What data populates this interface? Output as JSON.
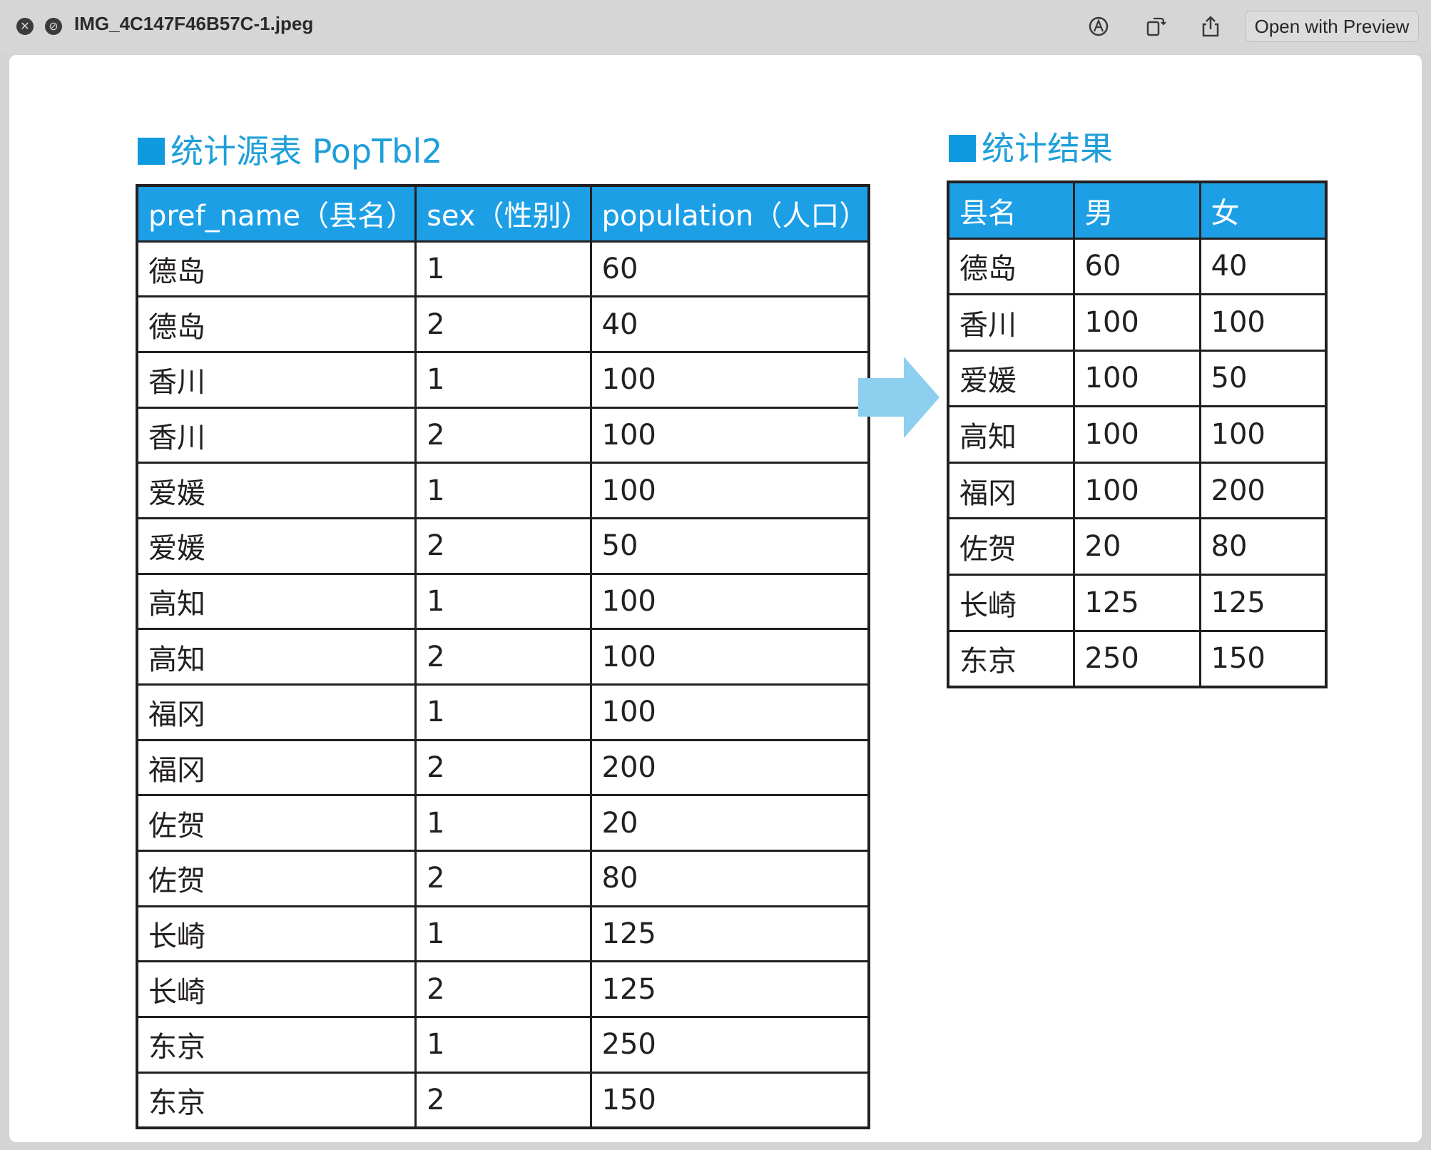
{
  "window": {
    "filename": "IMG_4C147F46B57C-1.jpeg",
    "open_button": "Open with Preview"
  },
  "source": {
    "heading": "统计源表 PopTbl2",
    "columns": [
      "pref_name（县名）",
      "sex（性别）",
      "population（人口）"
    ],
    "rows": [
      [
        "德岛",
        "1",
        "60"
      ],
      [
        "德岛",
        "2",
        "40"
      ],
      [
        "香川",
        "1",
        "100"
      ],
      [
        "香川",
        "2",
        "100"
      ],
      [
        "爱媛",
        "1",
        "100"
      ],
      [
        "爱媛",
        "2",
        "50"
      ],
      [
        "高知",
        "1",
        "100"
      ],
      [
        "高知",
        "2",
        "100"
      ],
      [
        "福冈",
        "1",
        "100"
      ],
      [
        "福冈",
        "2",
        "200"
      ],
      [
        "佐贺",
        "1",
        "20"
      ],
      [
        "佐贺",
        "2",
        "80"
      ],
      [
        "长崎",
        "1",
        "125"
      ],
      [
        "长崎",
        "2",
        "125"
      ],
      [
        "东京",
        "1",
        "250"
      ],
      [
        "东京",
        "2",
        "150"
      ]
    ]
  },
  "result": {
    "heading": "统计结果",
    "columns": [
      "县名",
      "男",
      "女"
    ],
    "rows": [
      [
        "德岛",
        "60",
        "40"
      ],
      [
        "香川",
        "100",
        "100"
      ],
      [
        "爱媛",
        "100",
        "50"
      ],
      [
        "高知",
        "100",
        "100"
      ],
      [
        "福冈",
        "100",
        "200"
      ],
      [
        "佐贺",
        "20",
        "80"
      ],
      [
        "长崎",
        "125",
        "125"
      ],
      [
        "东京",
        "250",
        "150"
      ]
    ]
  },
  "colors": {
    "header_fill": "#1d9fe6",
    "heading_text": "#1e9fd9",
    "arrow": "#8ccfef"
  }
}
